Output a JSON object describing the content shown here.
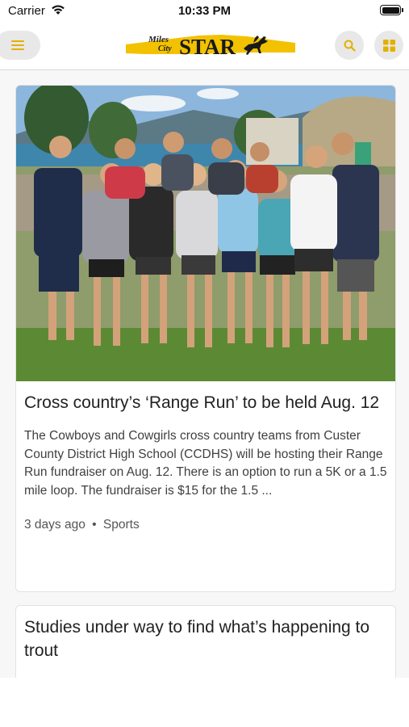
{
  "status_bar": {
    "carrier": "Carrier",
    "time": "10:33 PM"
  },
  "header": {
    "logo_small_1": "Miles",
    "logo_small_2": "City",
    "logo_main": "STAR",
    "accent_color": "#f2c200"
  },
  "articles": [
    {
      "headline": "Cross country’s ‘Range Run’ to be held Aug. 12",
      "summary": "The Cowboys and Cowgirls cross country teams from Custer County District High School (CCDHS) will be hosting their Range Run fundraiser on Aug. 12. There is an option to run a 5K or a 1.5 mile loop. The fundraiser is $15 for the 1.5 ...",
      "age": "3 days ago",
      "separator": "•",
      "category": "Sports"
    },
    {
      "headline": "Studies under way to find what’s happening to trout"
    }
  ]
}
